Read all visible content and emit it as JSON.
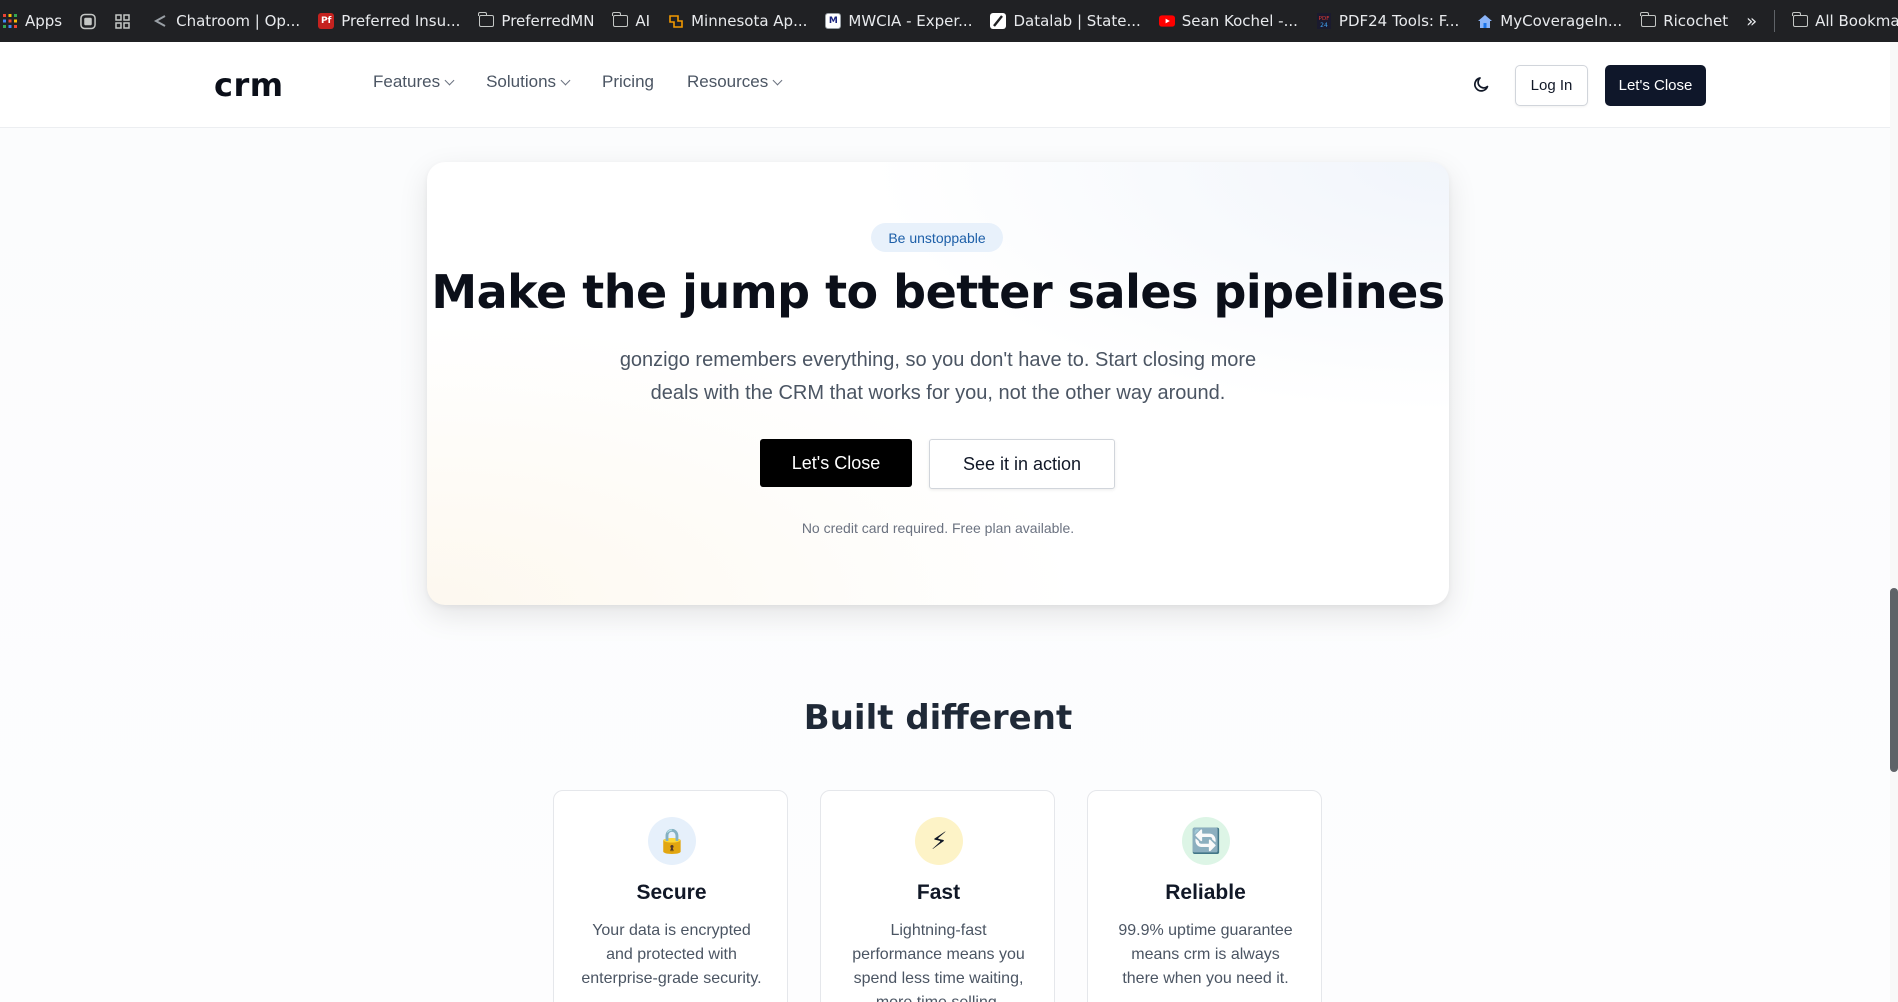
{
  "bookmarks": {
    "items": [
      {
        "label": "Apps",
        "icon": "apps-grid-icon"
      },
      {
        "label": "",
        "icon": "tab-group-icon"
      },
      {
        "label": "",
        "icon": "grid-icon"
      },
      {
        "label": "Chatroom | Op...",
        "icon": "chatroom-icon"
      },
      {
        "label": "Preferred Insu...",
        "icon": "pf-icon"
      },
      {
        "label": "PreferredMN",
        "icon": "folder-icon"
      },
      {
        "label": "AI",
        "icon": "folder-icon"
      },
      {
        "label": "Minnesota Ap...",
        "icon": "minnesota-icon"
      },
      {
        "label": "MWCIA - Exper...",
        "icon": "mwcia-icon"
      },
      {
        "label": "Datalab | State...",
        "icon": "datalab-icon"
      },
      {
        "label": "Sean Kochel -...",
        "icon": "youtube-icon"
      },
      {
        "label": "PDF24 Tools: F...",
        "icon": "pdf24-icon"
      },
      {
        "label": "MyCoverageIn...",
        "icon": "home-icon"
      },
      {
        "label": "Ricochet",
        "icon": "folder-icon"
      }
    ],
    "overflow": "»",
    "all_bookmarks": "All Bookmarks"
  },
  "nav": {
    "logo": "crm",
    "links": [
      {
        "label": "Features",
        "dropdown": true
      },
      {
        "label": "Solutions",
        "dropdown": true
      },
      {
        "label": "Pricing",
        "dropdown": false
      },
      {
        "label": "Resources",
        "dropdown": true
      }
    ],
    "login": "Log In",
    "cta": "Let's Close"
  },
  "hero": {
    "badge": "Be unstoppable",
    "title": "Make the jump to better sales pipelines",
    "subtitle_line1": "gonzigo remembers everything, so you don't have to. Start closing more",
    "subtitle_line2": "deals with the CRM that works for you, not the other way around.",
    "primary_button": "Let's Close",
    "secondary_button": "See it in action",
    "note": "No credit card required. Free plan available."
  },
  "features": {
    "title": "Built different",
    "cards": [
      {
        "icon": "🔒",
        "icon_name": "lock-icon",
        "icon_bg": "#e6f0fb",
        "title": "Secure",
        "lines": [
          "Your data is encrypted",
          "and protected with",
          "enterprise-grade security."
        ]
      },
      {
        "icon": "⚡",
        "icon_name": "lightning-icon",
        "icon_bg": "#fdf3c7",
        "title": "Fast",
        "lines": [
          "Lightning-fast",
          "performance means you",
          "spend less time waiting,",
          "more time selling."
        ]
      },
      {
        "icon": "🔄",
        "icon_name": "refresh-icon",
        "icon_bg": "#ddf5e6",
        "title": "Reliable",
        "lines": [
          "99.9% uptime guarantee",
          "means crm is always",
          "there when you need it."
        ]
      }
    ]
  },
  "colors": {
    "bookmarks_bg": "#202124",
    "primary_dark": "#0f172a",
    "badge_bg": "#e8f1fb",
    "badge_text": "#1d5fa8"
  }
}
